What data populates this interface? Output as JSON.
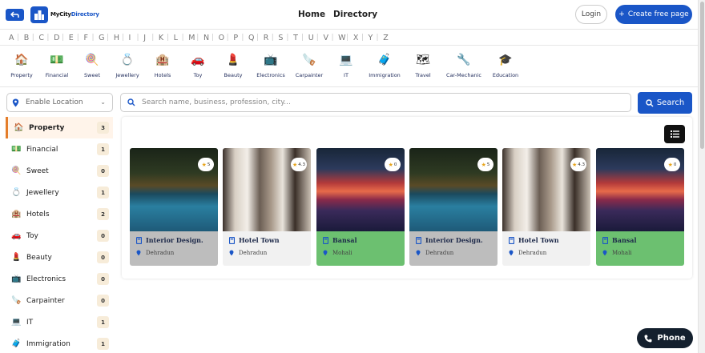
{
  "header": {
    "brand_prefix": "MyCity",
    "brand_suffix": "Directory",
    "nav_home": "Home",
    "nav_directory": "Directory",
    "login_label": "Login",
    "create_label": "Create free page"
  },
  "alphabet": [
    "A",
    "B",
    "C",
    "D",
    "E",
    "F",
    "G",
    "H",
    "I",
    "J",
    "K",
    "L",
    "M",
    "N",
    "O",
    "P",
    "Q",
    "R",
    "S",
    "T",
    "U",
    "V",
    "W",
    "X",
    "Y",
    "Z"
  ],
  "categories": [
    {
      "label": "Property",
      "icon": "house-icon"
    },
    {
      "label": "Financial",
      "icon": "money-icon"
    },
    {
      "label": "Sweet",
      "icon": "sweet-icon"
    },
    {
      "label": "Jewellery",
      "icon": "jewellery-icon"
    },
    {
      "label": "Hotels",
      "icon": "hotel-icon"
    },
    {
      "label": "Toy",
      "icon": "car-toy-icon"
    },
    {
      "label": "Beauty",
      "icon": "beauty-icon"
    },
    {
      "label": "Electronics",
      "icon": "electronics-icon"
    },
    {
      "label": "Carpainter",
      "icon": "carpenter-icon"
    },
    {
      "label": "IT",
      "icon": "computer-icon"
    },
    {
      "label": "Immigration",
      "icon": "immigration-icon"
    },
    {
      "label": "Travel",
      "icon": "travel-icon"
    },
    {
      "label": "Car-Mechanic",
      "icon": "mechanic-icon"
    },
    {
      "label": "Education",
      "icon": "education-icon"
    }
  ],
  "location": {
    "label": "Enable Location"
  },
  "search": {
    "placeholder": "Search name, business, profession, city...",
    "button_label": "Search"
  },
  "sidebar": [
    {
      "label": "Property",
      "count": "3"
    },
    {
      "label": "Financial",
      "count": "1"
    },
    {
      "label": "Sweet",
      "count": "0"
    },
    {
      "label": "Jewellery",
      "count": "1"
    },
    {
      "label": "Hotels",
      "count": "2"
    },
    {
      "label": "Toy",
      "count": "0"
    },
    {
      "label": "Beauty",
      "count": "0"
    },
    {
      "label": "Electronics",
      "count": "0"
    },
    {
      "label": "Carpainter",
      "count": "0"
    },
    {
      "label": "IT",
      "count": "1"
    },
    {
      "label": "Immigration",
      "count": "1"
    }
  ],
  "cards": [
    {
      "title": "Interior Design.",
      "city": "Dehradun",
      "rating": "5",
      "image": "pool",
      "info_color": "#bdbdbd"
    },
    {
      "title": "Hotel Town",
      "city": "Dehradun",
      "rating": "4.3",
      "image": "hotel",
      "info_color": "#f1f1f1"
    },
    {
      "title": "Bansal",
      "city": "Mohali",
      "rating": "0",
      "image": "bansal",
      "info_color": "#6cc070"
    },
    {
      "title": "Interior Design.",
      "city": "Dehradun",
      "rating": "5",
      "image": "pool",
      "info_color": "#bdbdbd"
    },
    {
      "title": "Hotel Town",
      "city": "Dehradun",
      "rating": "4.3",
      "image": "hotel",
      "info_color": "#f1f1f1"
    },
    {
      "title": "Bansal",
      "city": "Mohali",
      "rating": "0",
      "image": "bansal",
      "info_color": "#6cc070"
    }
  ],
  "phone_button": {
    "label": "Phone"
  },
  "colors": {
    "primary": "#1a56c7",
    "active_accent": "#e47d2a"
  }
}
